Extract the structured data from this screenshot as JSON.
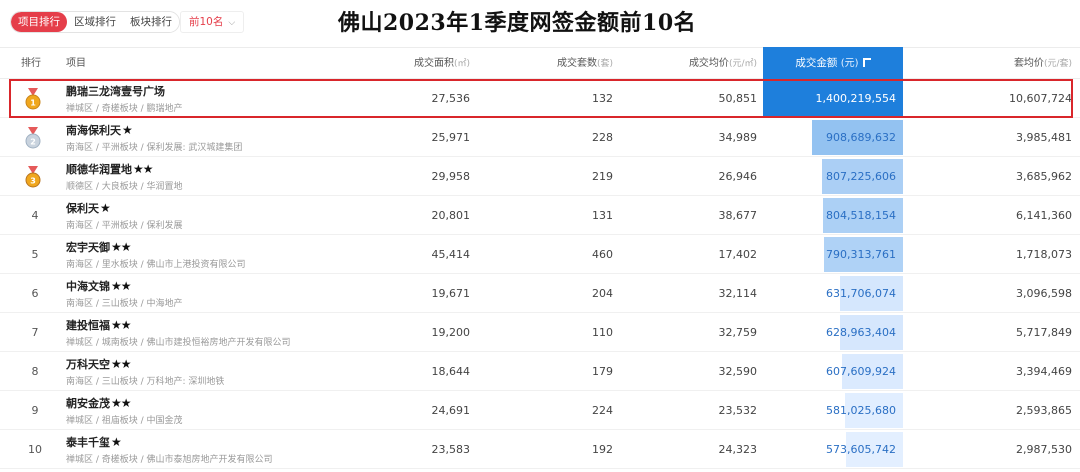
{
  "filters": {
    "tabs": [
      {
        "label": "项目排行",
        "active": true
      },
      {
        "label": "区域排行",
        "active": false
      },
      {
        "label": "板块排行",
        "active": false
      }
    ],
    "top_n": "前10名"
  },
  "page_title": "佛山2023年1季度网签金额前10名",
  "columns": {
    "rank": "排行",
    "project": "项目",
    "area": "成交面积",
    "area_unit": "(㎡)",
    "sets": "成交套数",
    "sets_unit": "(套)",
    "avg_price": "成交均价",
    "avg_price_unit": "(元/㎡)",
    "amount": "成交金额",
    "amount_unit": "(元)",
    "per_set": "套均价",
    "per_set_unit": "(元/套)"
  },
  "colors": {
    "accent": "#e53e4a",
    "sort_header": "#1e7fdc",
    "highlight_border": "#d9262b",
    "bar_max": "#1e7fdc",
    "bar_min": "#e3efff"
  },
  "rows": [
    {
      "rank": "1",
      "medal": "gold",
      "name": "鹏瑞三龙湾壹号广场",
      "stars": "",
      "sub": "禅城区 / 奇槎板块 / 鹏瑞地产",
      "area": "27,536",
      "sets": "132",
      "avg_price": "50,851",
      "amount": "1,400,219,554",
      "amount_value": 1400219554,
      "per_set": "10,607,724",
      "highlighted": true
    },
    {
      "rank": "2",
      "medal": "silver",
      "name": "南海保利天",
      "stars": "★",
      "sub": "南海区 / 平洲板块 / 保利发展: 武汉城建集团",
      "area": "25,971",
      "sets": "228",
      "avg_price": "34,989",
      "amount": "908,689,632",
      "amount_value": 908689632,
      "per_set": "3,985,481",
      "highlighted": false
    },
    {
      "rank": "3",
      "medal": "bronze",
      "name": "顺德华润置地",
      "stars": "★★",
      "sub": "顺德区 / 大良板块 / 华润置地",
      "area": "29,958",
      "sets": "219",
      "avg_price": "26,946",
      "amount": "807,225,606",
      "amount_value": 807225606,
      "per_set": "3,685,962",
      "highlighted": false
    },
    {
      "rank": "4",
      "medal": "",
      "name": "保利天",
      "stars": "★",
      "sub": "南海区 / 平洲板块 / 保利发展",
      "area": "20,801",
      "sets": "131",
      "avg_price": "38,677",
      "amount": "804,518,154",
      "amount_value": 804518154,
      "per_set": "6,141,360",
      "highlighted": false
    },
    {
      "rank": "5",
      "medal": "",
      "name": "宏宇天御",
      "stars": "★★",
      "sub": "南海区 / 里水板块 / 佛山市上港投资有限公司",
      "area": "45,414",
      "sets": "460",
      "avg_price": "17,402",
      "amount": "790,313,761",
      "amount_value": 790313761,
      "per_set": "1,718,073",
      "highlighted": false
    },
    {
      "rank": "6",
      "medal": "",
      "name": "中海文锦",
      "stars": "★★",
      "sub": "南海区 / 三山板块 / 中海地产",
      "area": "19,671",
      "sets": "204",
      "avg_price": "32,114",
      "amount": "631,706,074",
      "amount_value": 631706074,
      "per_set": "3,096,598",
      "highlighted": false
    },
    {
      "rank": "7",
      "medal": "",
      "name": "建投恒福",
      "stars": "★★",
      "sub": "禅城区 / 城南板块 / 佛山市建投恒裕房地产开发有限公司",
      "area": "19,200",
      "sets": "110",
      "avg_price": "32,759",
      "amount": "628,963,404",
      "amount_value": 628963404,
      "per_set": "5,717,849",
      "highlighted": false
    },
    {
      "rank": "8",
      "medal": "",
      "name": "万科天空",
      "stars": "★★",
      "sub": "南海区 / 三山板块 / 万科地产: 深圳地铁",
      "area": "18,644",
      "sets": "179",
      "avg_price": "32,590",
      "amount": "607,609,924",
      "amount_value": 607609924,
      "per_set": "3,394,469",
      "highlighted": false
    },
    {
      "rank": "9",
      "medal": "",
      "name": "朝安金茂",
      "stars": "★★",
      "sub": "禅城区 / 祖庙板块 / 中国金茂",
      "area": "24,691",
      "sets": "224",
      "avg_price": "23,532",
      "amount": "581,025,680",
      "amount_value": 581025680,
      "per_set": "2,593,865",
      "highlighted": false
    },
    {
      "rank": "10",
      "medal": "",
      "name": "泰丰千玺",
      "stars": "★",
      "sub": "禅城区 / 奇槎板块 / 佛山市泰旭房地产开发有限公司",
      "area": "23,583",
      "sets": "192",
      "avg_price": "24,323",
      "amount": "573,605,742",
      "amount_value": 573605742,
      "per_set": "2,987,530",
      "highlighted": false
    }
  ]
}
